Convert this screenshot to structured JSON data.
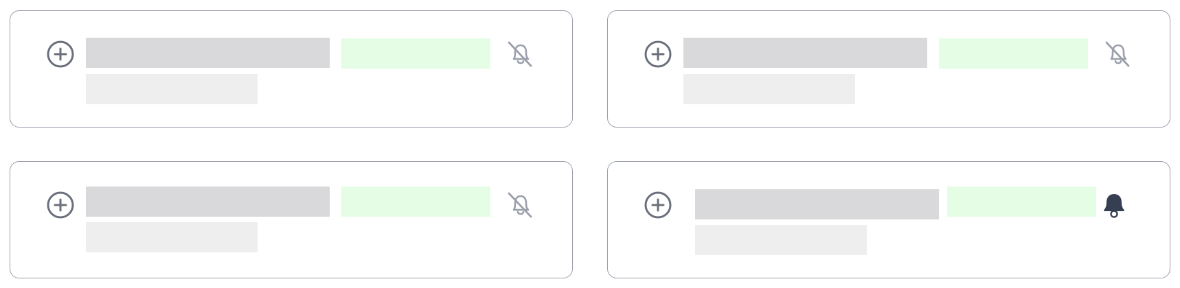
{
  "colors": {
    "card_border": "#9a9fab",
    "icon_muted": "#9a9fab",
    "icon_dark": "#363f52",
    "add_icon": "#6a6f7c",
    "skeleton_title": "#d9d8da",
    "skeleton_subtitle": "#efeeef",
    "skeleton_tag": "#e5fce5"
  },
  "cards": [
    {
      "bell_state": "muted",
      "bell_icon": "bell-off-icon"
    },
    {
      "bell_state": "muted",
      "bell_icon": "bell-off-icon"
    },
    {
      "bell_state": "muted",
      "bell_icon": "bell-off-icon"
    },
    {
      "bell_state": "active",
      "bell_icon": "bell-filled-icon"
    }
  ]
}
